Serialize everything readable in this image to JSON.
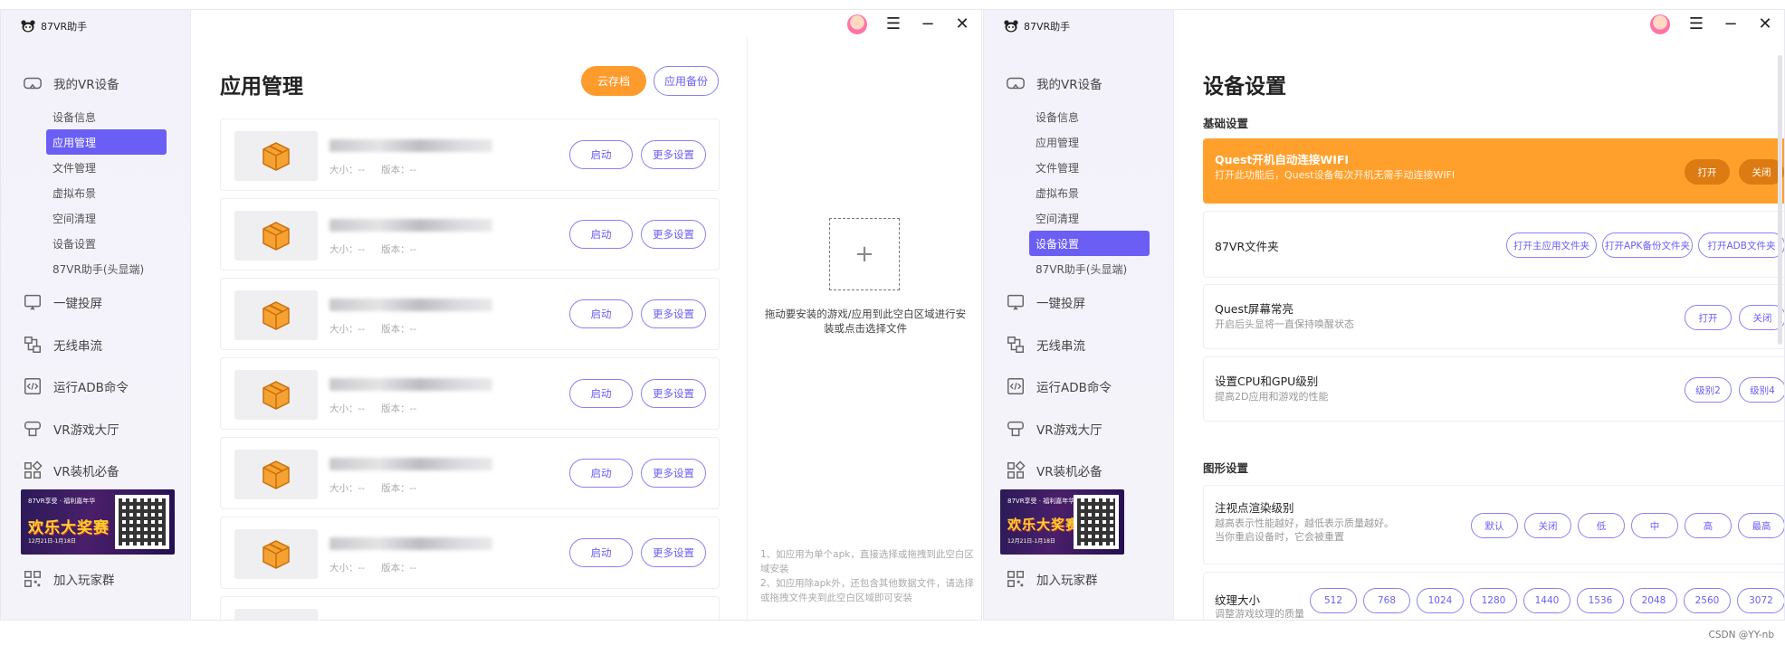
{
  "app": {
    "brand": "87VR助手"
  },
  "sidebar": {
    "main": {
      "label": "我的VR设备"
    },
    "subitems": [
      "设备信息",
      "应用管理",
      "文件管理",
      "虚拟布景",
      "空间清理",
      "设备设置",
      "87VR助手(头显端)"
    ],
    "groups": [
      {
        "label": "一键投屏",
        "icon": "cast-screen-icon"
      },
      {
        "label": "无线串流",
        "icon": "stream-icon"
      },
      {
        "label": "运行ADB命令",
        "icon": "code-icon"
      },
      {
        "label": "VR游戏大厅",
        "icon": "vr-hall-icon"
      },
      {
        "label": "VR装机必备",
        "icon": "apps-grid-icon"
      }
    ],
    "banner": {
      "top": "87VR享受 · 福利嘉年华",
      "title": "欢乐大奖赛",
      "sub": "12月21日-1月18日"
    },
    "join": "加入玩家群"
  },
  "left_window": {
    "active_sub": "应用管理",
    "title": "应用管理",
    "cloud_button": "云存档",
    "backup_button": "应用备份",
    "apps": [
      {
        "size_label": "大小：--",
        "version_label": "版本：--",
        "start": "启动",
        "more": "更多设置"
      },
      {
        "size_label": "大小：--",
        "version_label": "版本：--",
        "start": "启动",
        "more": "更多设置"
      },
      {
        "size_label": "大小：--",
        "version_label": "版本：--",
        "start": "启动",
        "more": "更多设置"
      },
      {
        "size_label": "大小：--",
        "version_label": "版本：--",
        "start": "启动",
        "more": "更多设置"
      },
      {
        "size_label": "大小：--",
        "version_label": "版本：--",
        "start": "启动",
        "more": "更多设置"
      },
      {
        "size_label": "大小：--",
        "version_label": "版本：--",
        "start": "启动",
        "more": "更多设置"
      }
    ],
    "drop_text": "拖动要安装的游戏/应用到此空白区域进行安装或点击选择文件",
    "drop_plus": "+",
    "tips": [
      "1、如应用为单个apk，直接选择或拖拽到此空白区域安装",
      "2、如应用除apk外，还包含其他数据文件，请选择或拖拽文件夹到此空白区域即可安装"
    ]
  },
  "right_window": {
    "active_sub": "设备设置",
    "title": "设备设置",
    "basic_section": "基础设置",
    "graphics_section": "图形设置",
    "settings": {
      "wifi": {
        "title": "Quest开机自动连接WIFI",
        "desc": "打开此功能后，Quest设备每次开机无需手动连接WIFI",
        "on": "打开",
        "off": "关闭"
      },
      "folder": {
        "title": "87VR文件夹",
        "btn1": "打开主应用文件夹",
        "btn2": "打开APK备份文件夹",
        "btn3": "打开ADB文件夹"
      },
      "screen": {
        "title": "Quest屏幕常亮",
        "desc": "开启后头显将一直保持唤醒状态",
        "on": "打开",
        "off": "关闭"
      },
      "cpu": {
        "title": "设置CPU和GPU级别",
        "desc": "提高2D应用和游戏的性能",
        "l2": "级别2",
        "l4": "级别4"
      },
      "foveated": {
        "title": "注视点渲染级别",
        "desc_line1": "越高表示性能越好，越低表示质量越好。",
        "desc_line2": "当你重启设备时，它会被重置",
        "options": [
          "默认",
          "关闭",
          "低",
          "中",
          "高",
          "最高"
        ]
      },
      "texture": {
        "title": "纹理大小",
        "desc": "调整游戏纹理的质量",
        "options": [
          "512",
          "768",
          "1024",
          "1280",
          "1440",
          "1536",
          "2048",
          "2560",
          "3072"
        ]
      }
    }
  },
  "watermark": "CSDN @YY-nb",
  "colors": {
    "accent": "#6a5ef5",
    "orange": "#fd9b2c",
    "sidebar_bg": "#f3f2fb"
  }
}
